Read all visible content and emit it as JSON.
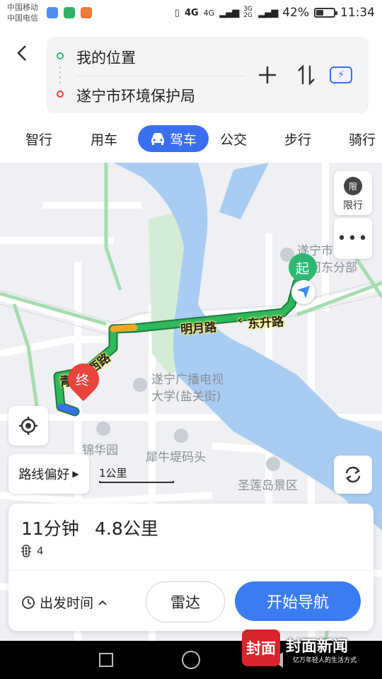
{
  "status_bar": {
    "carrier1": "中国移动",
    "carrier2": "中国电信",
    "net1": "4G",
    "net2": "4G",
    "net3": "3G 2G",
    "battery": "42%",
    "battery_level": 0.42,
    "time": "11:34"
  },
  "header": {
    "back_icon": "chevron-left",
    "origin": "我的位置",
    "destination": "遂宁市环境保护局",
    "add_icon": "plus",
    "swap_icon": "swap-vertical",
    "traffic_icon": "route-traffic"
  },
  "tabs": [
    {
      "label": "智行"
    },
    {
      "label": "用车"
    },
    {
      "label": "驾车",
      "active": true,
      "icon": "car"
    },
    {
      "label": "公交"
    },
    {
      "label": "步行"
    },
    {
      "label": "骑行"
    }
  ],
  "map": {
    "restriction_label": "限行",
    "restriction_icon_text": "限",
    "more_icon": "ellipsis",
    "labels": {
      "poi_top_line1": "遂宁市",
      "poi_top_line2": "院河东分部",
      "university_line1": "遂宁广播电视",
      "university_line2": "大学(盐关街)",
      "jinhua": "锦华园",
      "xiniu": "犀牛堤码头",
      "shenglian": "圣莲岛景区",
      "road_mingyue": "明月路",
      "road_dongsheng": "东升路",
      "road_west": "西路",
      "road_west_prefix": "青"
    },
    "start_pin": "起",
    "end_pin": "终",
    "route_pref_label": "路线偏好",
    "scale_label": "1公里",
    "locate_icon": "locate",
    "refresh_icon": "refresh",
    "colors": {
      "route_green": "#2db85c",
      "route_orange": "#f5a623",
      "route_blue": "#3b6ff1",
      "water": "#a9cdf2",
      "park": "#d4ecd5"
    }
  },
  "summary": {
    "duration": "11分钟",
    "distance": "4.8公里",
    "traffic_lights": "4",
    "traffic_light_icon": "traffic-light",
    "depart_label": "出发时间",
    "radar_label": "雷达",
    "start_nav_label": "开始导航"
  },
  "watermark": {
    "logo_text": "封面",
    "brand": "封面新闻",
    "slogan": "亿万年轻人的生活方式"
  }
}
